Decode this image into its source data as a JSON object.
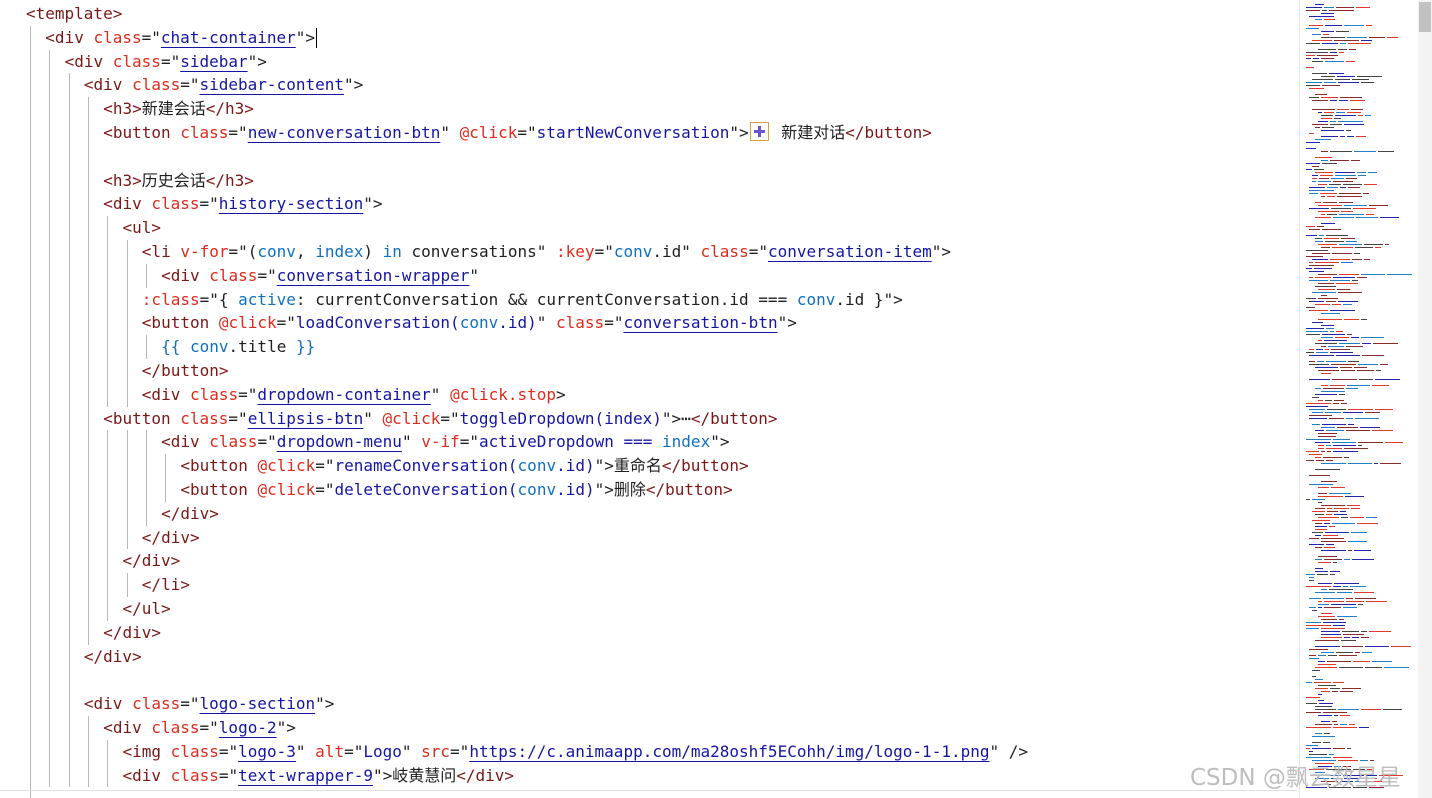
{
  "watermark": "CSDN @飘云数星星",
  "code_lines": [
    {
      "indent": 0,
      "cursor": false,
      "tokens": [
        {
          "t": "<template>",
          "c": "t"
        }
      ]
    },
    {
      "indent": 1,
      "cursor": true,
      "tokens": [
        {
          "t": "<div ",
          "c": "t"
        },
        {
          "t": "class",
          "c": "a"
        },
        {
          "t": "=\"",
          "c": "x"
        },
        {
          "t": "chat-container",
          "c": "s u"
        },
        {
          "t": "\">",
          "c": "x"
        }
      ]
    },
    {
      "indent": 2,
      "cursor": false,
      "tokens": [
        {
          "t": "<div ",
          "c": "t"
        },
        {
          "t": "class",
          "c": "a"
        },
        {
          "t": "=\"",
          "c": "x"
        },
        {
          "t": "sidebar",
          "c": "s u"
        },
        {
          "t": "\">",
          "c": "x"
        }
      ]
    },
    {
      "indent": 3,
      "cursor": false,
      "tokens": [
        {
          "t": "<div ",
          "c": "t"
        },
        {
          "t": "class",
          "c": "a"
        },
        {
          "t": "=\"",
          "c": "x"
        },
        {
          "t": "sidebar-content",
          "c": "s u"
        },
        {
          "t": "\">",
          "c": "x"
        }
      ]
    },
    {
      "indent": 4,
      "cursor": false,
      "tokens": [
        {
          "t": "<h3>",
          "c": "t"
        },
        {
          "t": "新建会话",
          "c": "x"
        },
        {
          "t": "</h3>",
          "c": "t"
        }
      ]
    },
    {
      "indent": 4,
      "cursor": false,
      "tokens": [
        {
          "t": "<button ",
          "c": "t"
        },
        {
          "t": "class",
          "c": "a"
        },
        {
          "t": "=\"",
          "c": "x"
        },
        {
          "t": "new-conversation-btn",
          "c": "s u"
        },
        {
          "t": "\" ",
          "c": "x"
        },
        {
          "t": "@click",
          "c": "a"
        },
        {
          "t": "=\"",
          "c": "x"
        },
        {
          "t": "startNewConversation",
          "c": "s"
        },
        {
          "t": "\">",
          "c": "x"
        },
        {
          "icon": "plus-icon"
        },
        {
          "t": " 新建对话",
          "c": "x"
        },
        {
          "t": "</button>",
          "c": "t"
        }
      ]
    },
    {
      "indent": 0,
      "cursor": false,
      "tokens": []
    },
    {
      "indent": 4,
      "cursor": false,
      "tokens": [
        {
          "t": "<h3>",
          "c": "t"
        },
        {
          "t": "历史会话",
          "c": "x"
        },
        {
          "t": "</h3>",
          "c": "t"
        }
      ]
    },
    {
      "indent": 4,
      "cursor": false,
      "tokens": [
        {
          "t": "<div ",
          "c": "t"
        },
        {
          "t": "class",
          "c": "a"
        },
        {
          "t": "=\"",
          "c": "x"
        },
        {
          "t": "history-section",
          "c": "s u"
        },
        {
          "t": "\">",
          "c": "x"
        }
      ]
    },
    {
      "indent": 5,
      "cursor": false,
      "tokens": [
        {
          "t": "<ul>",
          "c": "t"
        }
      ]
    },
    {
      "indent": 6,
      "cursor": false,
      "tokens": [
        {
          "t": "<li ",
          "c": "t"
        },
        {
          "t": "v-for",
          "c": "a"
        },
        {
          "t": "=\"(",
          "c": "x"
        },
        {
          "t": "conv",
          "c": "v"
        },
        {
          "t": ", ",
          "c": "x"
        },
        {
          "t": "index",
          "c": "v"
        },
        {
          "t": ") ",
          "c": "x"
        },
        {
          "t": "in",
          "c": "v"
        },
        {
          "t": " conversations\" ",
          "c": "x"
        },
        {
          "t": ":key",
          "c": "a"
        },
        {
          "t": "=\"",
          "c": "x"
        },
        {
          "t": "conv",
          "c": "v"
        },
        {
          "t": ".id\" ",
          "c": "x"
        },
        {
          "t": "class",
          "c": "a"
        },
        {
          "t": "=\"",
          "c": "x"
        },
        {
          "t": "conversation-item",
          "c": "s u"
        },
        {
          "t": "\">",
          "c": "x"
        }
      ]
    },
    {
      "indent": 7,
      "cursor": false,
      "tokens": [
        {
          "t": "<div ",
          "c": "t"
        },
        {
          "t": "class",
          "c": "a"
        },
        {
          "t": "=\"",
          "c": "x"
        },
        {
          "t": "conversation-wrapper",
          "c": "s u"
        },
        {
          "t": "\"",
          "c": "x"
        }
      ]
    },
    {
      "indent": 6,
      "cursor": false,
      "tokens": [
        {
          "t": ":class",
          "c": "a"
        },
        {
          "t": "=\"{ ",
          "c": "x"
        },
        {
          "t": "active",
          "c": "v"
        },
        {
          "t": ": currentConversation && currentConversation.id === ",
          "c": "x"
        },
        {
          "t": "conv",
          "c": "v"
        },
        {
          "t": ".id }\">",
          "c": "x"
        }
      ]
    },
    {
      "indent": 6,
      "cursor": false,
      "tokens": [
        {
          "t": "<button ",
          "c": "t"
        },
        {
          "t": "@click",
          "c": "a"
        },
        {
          "t": "=\"",
          "c": "x"
        },
        {
          "t": "loadConversation(",
          "c": "s"
        },
        {
          "t": "conv",
          "c": "v"
        },
        {
          "t": ".id)",
          "c": "s"
        },
        {
          "t": "\" ",
          "c": "x"
        },
        {
          "t": "class",
          "c": "a"
        },
        {
          "t": "=\"",
          "c": "x"
        },
        {
          "t": "conversation-btn",
          "c": "s u"
        },
        {
          "t": "\">",
          "c": "x"
        }
      ]
    },
    {
      "indent": 7,
      "cursor": false,
      "tokens": [
        {
          "t": "{{ ",
          "c": "v"
        },
        {
          "t": "conv",
          "c": "v"
        },
        {
          "t": ".title ",
          "c": "x"
        },
        {
          "t": "}}",
          "c": "v"
        }
      ]
    },
    {
      "indent": 6,
      "cursor": false,
      "tokens": [
        {
          "t": "</button>",
          "c": "t"
        }
      ]
    },
    {
      "indent": 6,
      "cursor": false,
      "tokens": [
        {
          "t": "<div ",
          "c": "t"
        },
        {
          "t": "class",
          "c": "a"
        },
        {
          "t": "=\"",
          "c": "x"
        },
        {
          "t": "dropdown-container",
          "c": "s u"
        },
        {
          "t": "\" ",
          "c": "x"
        },
        {
          "t": "@click.stop",
          "c": "a"
        },
        {
          "t": ">",
          "c": "x"
        }
      ]
    },
    {
      "indent": 4,
      "cursor": false,
      "tokens": [
        {
          "t": "<button ",
          "c": "t"
        },
        {
          "t": "class",
          "c": "a"
        },
        {
          "t": "=\"",
          "c": "x"
        },
        {
          "t": "ellipsis-btn",
          "c": "s u"
        },
        {
          "t": "\" ",
          "c": "x"
        },
        {
          "t": "@click",
          "c": "a"
        },
        {
          "t": "=\"",
          "c": "x"
        },
        {
          "t": "toggleDropdown(index)",
          "c": "s"
        },
        {
          "t": "\">⋯",
          "c": "x"
        },
        {
          "t": "</button>",
          "c": "t"
        }
      ]
    },
    {
      "indent": 7,
      "cursor": false,
      "tokens": [
        {
          "t": "<div ",
          "c": "t"
        },
        {
          "t": "class",
          "c": "a"
        },
        {
          "t": "=\"",
          "c": "x"
        },
        {
          "t": "dropdown-menu",
          "c": "s u"
        },
        {
          "t": "\" ",
          "c": "x"
        },
        {
          "t": "v-if",
          "c": "a"
        },
        {
          "t": "=\"",
          "c": "x"
        },
        {
          "t": "activeDropdown === ",
          "c": "s"
        },
        {
          "t": "index",
          "c": "v"
        },
        {
          "t": "\">",
          "c": "x"
        }
      ]
    },
    {
      "indent": 8,
      "cursor": false,
      "tokens": [
        {
          "t": "<button ",
          "c": "t"
        },
        {
          "t": "@click",
          "c": "a"
        },
        {
          "t": "=\"",
          "c": "x"
        },
        {
          "t": "renameConversation(",
          "c": "s"
        },
        {
          "t": "conv",
          "c": "v"
        },
        {
          "t": ".id)",
          "c": "s"
        },
        {
          "t": "\">",
          "c": "x"
        },
        {
          "t": "重命名",
          "c": "x"
        },
        {
          "t": "</button>",
          "c": "t"
        }
      ]
    },
    {
      "indent": 8,
      "cursor": false,
      "tokens": [
        {
          "t": "<button ",
          "c": "t"
        },
        {
          "t": "@click",
          "c": "a"
        },
        {
          "t": "=\"",
          "c": "x"
        },
        {
          "t": "deleteConversation(",
          "c": "s"
        },
        {
          "t": "conv",
          "c": "v"
        },
        {
          "t": ".id)",
          "c": "s"
        },
        {
          "t": "\">",
          "c": "x"
        },
        {
          "t": "删除",
          "c": "x"
        },
        {
          "t": "</button>",
          "c": "t"
        }
      ]
    },
    {
      "indent": 7,
      "cursor": false,
      "tokens": [
        {
          "t": "</div>",
          "c": "t"
        }
      ]
    },
    {
      "indent": 6,
      "cursor": false,
      "tokens": [
        {
          "t": "</div>",
          "c": "t"
        }
      ]
    },
    {
      "indent": 5,
      "cursor": false,
      "tokens": [
        {
          "t": "</div>",
          "c": "t"
        }
      ]
    },
    {
      "indent": 6,
      "cursor": false,
      "tokens": [
        {
          "t": "</li>",
          "c": "t"
        }
      ]
    },
    {
      "indent": 5,
      "cursor": false,
      "tokens": [
        {
          "t": "</ul>",
          "c": "t"
        }
      ]
    },
    {
      "indent": 4,
      "cursor": false,
      "tokens": [
        {
          "t": "</div>",
          "c": "t"
        }
      ]
    },
    {
      "indent": 3,
      "cursor": false,
      "tokens": [
        {
          "t": "</div>",
          "c": "t"
        }
      ]
    },
    {
      "indent": 0,
      "cursor": false,
      "tokens": []
    },
    {
      "indent": 3,
      "cursor": false,
      "tokens": [
        {
          "t": "<div ",
          "c": "t"
        },
        {
          "t": "class",
          "c": "a"
        },
        {
          "t": "=\"",
          "c": "x"
        },
        {
          "t": "logo-section",
          "c": "s u"
        },
        {
          "t": "\">",
          "c": "x"
        }
      ]
    },
    {
      "indent": 4,
      "cursor": false,
      "tokens": [
        {
          "t": "<div ",
          "c": "t"
        },
        {
          "t": "class",
          "c": "a"
        },
        {
          "t": "=\"",
          "c": "x"
        },
        {
          "t": "logo-2",
          "c": "s u"
        },
        {
          "t": "\">",
          "c": "x"
        }
      ]
    },
    {
      "indent": 5,
      "cursor": false,
      "tokens": [
        {
          "t": "<img ",
          "c": "t"
        },
        {
          "t": "class",
          "c": "a"
        },
        {
          "t": "=\"",
          "c": "x"
        },
        {
          "t": "logo-3",
          "c": "s u"
        },
        {
          "t": "\" ",
          "c": "x"
        },
        {
          "t": "alt",
          "c": "a"
        },
        {
          "t": "=\"",
          "c": "x"
        },
        {
          "t": "Logo",
          "c": "s"
        },
        {
          "t": "\" ",
          "c": "x"
        },
        {
          "t": "src",
          "c": "a"
        },
        {
          "t": "=\"",
          "c": "x"
        },
        {
          "t": "https://c.animaapp.com/ma28oshf5ECohh/img/logo-1-1.png",
          "c": "s u"
        },
        {
          "t": "\" />",
          "c": "x"
        }
      ]
    },
    {
      "indent": 5,
      "cursor": false,
      "tokens": [
        {
          "t": "<div ",
          "c": "t"
        },
        {
          "t": "class",
          "c": "a"
        },
        {
          "t": "=\"",
          "c": "x"
        },
        {
          "t": "text-wrapper-9",
          "c": "s u"
        },
        {
          "t": "\">",
          "c": "x"
        },
        {
          "t": "岐黄慧问",
          "c": "x"
        },
        {
          "t": "</div>",
          "c": "t"
        }
      ]
    }
  ]
}
